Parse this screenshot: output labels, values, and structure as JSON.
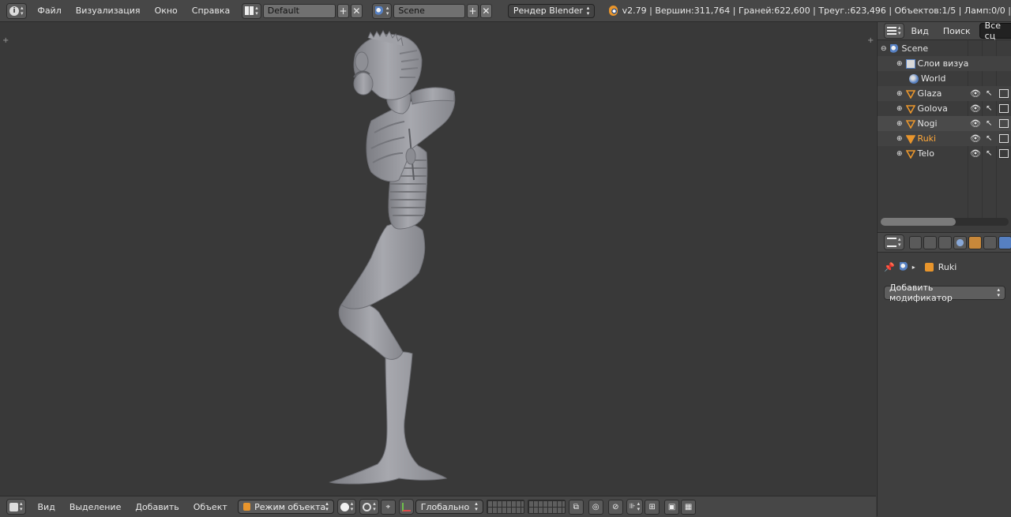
{
  "topbar": {
    "menus": [
      "Файл",
      "Визуализация",
      "Окно",
      "Справка"
    ],
    "screen_layout": "Default",
    "scene": "Scene",
    "render_engine": "Рендер Blender",
    "stats": "v2.79 | Вершин:311,764 | Граней:622,600 | Треуг.:623,496 | Объектов:1/5 | Ламп:0/0 |"
  },
  "outliner": {
    "view": "Вид",
    "search": "Поиск",
    "display_mode": "Все сц",
    "items": [
      {
        "label": "Scene",
        "type": "scene"
      },
      {
        "label": "Слои визуа",
        "type": "render-layers"
      },
      {
        "label": "World",
        "type": "world"
      },
      {
        "label": "Glaza",
        "type": "mesh"
      },
      {
        "label": "Golova",
        "type": "mesh"
      },
      {
        "label": "Nogi",
        "type": "mesh"
      },
      {
        "label": "Ruki",
        "type": "mesh",
        "selected": true
      },
      {
        "label": "Telo",
        "type": "mesh"
      }
    ]
  },
  "properties": {
    "object_name": "Ruki",
    "add_modifier": "Добавить модификатор"
  },
  "bottombar": {
    "menus": [
      "Вид",
      "Выделение",
      "Добавить",
      "Объект"
    ],
    "mode": "Режим объекта",
    "orientation": "Глобально"
  },
  "colors": {
    "accent": "#5680c2",
    "mesh_icon": "#e8952c",
    "model": "#9fa0a6"
  }
}
